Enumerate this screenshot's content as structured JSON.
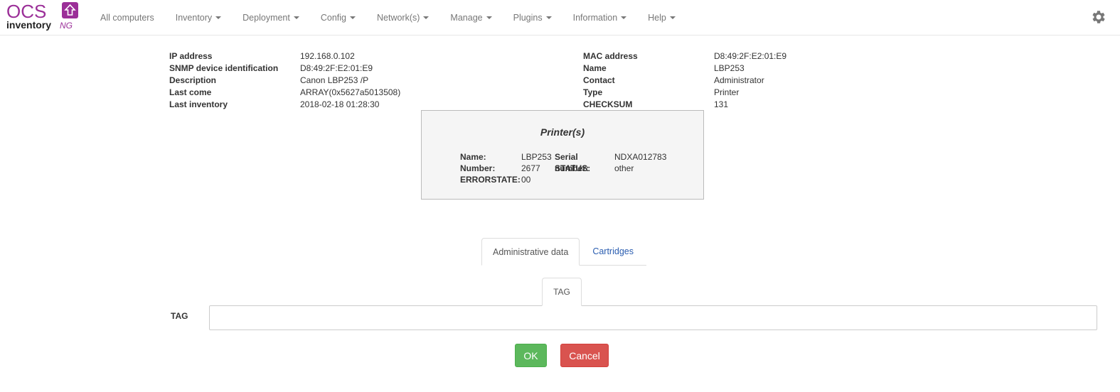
{
  "brand": {
    "logo_text_top": "OCS",
    "logo_text_bottom": "inventory",
    "logo_suffix": "NG",
    "color": "#9b2f98"
  },
  "nav": {
    "items": [
      {
        "label": "All computers",
        "dropdown": false
      },
      {
        "label": "Inventory",
        "dropdown": true
      },
      {
        "label": "Deployment",
        "dropdown": true
      },
      {
        "label": "Config",
        "dropdown": true
      },
      {
        "label": "Network(s)",
        "dropdown": true
      },
      {
        "label": "Manage",
        "dropdown": true
      },
      {
        "label": "Plugins",
        "dropdown": true
      },
      {
        "label": "Information",
        "dropdown": true
      },
      {
        "label": "Help",
        "dropdown": true
      }
    ],
    "settings_icon": "gear-icon"
  },
  "device": {
    "left": [
      {
        "label": "IP address",
        "value": "192.168.0.102"
      },
      {
        "label": "SNMP device identification",
        "value": "D8:49:2F:E2:01:E9"
      },
      {
        "label": "Description",
        "value": "Canon LBP253 /P"
      },
      {
        "label": "Last come",
        "value": "ARRAY(0x5627a5013508)"
      },
      {
        "label": "Last inventory",
        "value": "2018-02-18 01:28:30"
      }
    ],
    "right": [
      {
        "label": "MAC address",
        "value": "D8:49:2F:E2:01:E9"
      },
      {
        "label": "Name",
        "value": "LBP253"
      },
      {
        "label": "Contact",
        "value": "Administrator"
      },
      {
        "label": "Type",
        "value": "Printer"
      },
      {
        "label": "CHECKSUM",
        "value": "131"
      }
    ]
  },
  "printer": {
    "title": "Printer(s)",
    "name_label": "Name:",
    "name_value": "LBP253",
    "serial_label": "Serial number:",
    "serial_value": "NDXA012783",
    "number_label": "Number:",
    "number_value": "2677",
    "status_label": "STATUS:",
    "status_value": "other",
    "errorstate_label": "ERRORSTATE:",
    "errorstate_value": "00"
  },
  "tabs": {
    "items": [
      {
        "label": "Administrative data",
        "active": true
      },
      {
        "label": "Cartridges",
        "active": false
      }
    ],
    "subtab": "TAG"
  },
  "form": {
    "tag_label": "TAG",
    "tag_value": "",
    "ok_label": "OK",
    "cancel_label": "Cancel"
  }
}
